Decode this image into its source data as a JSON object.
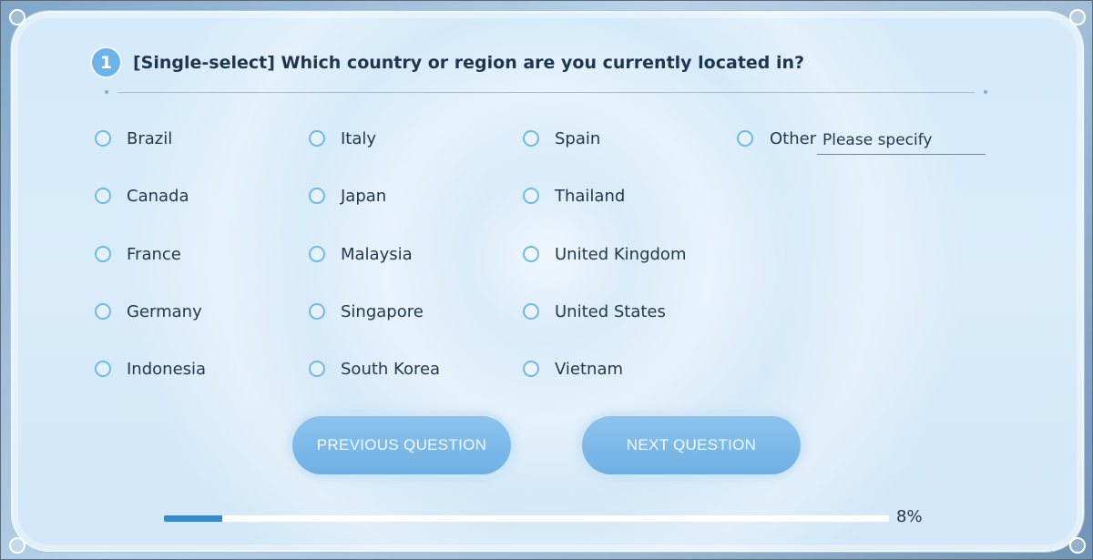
{
  "question": {
    "number": "1",
    "text": "[Single-select] Which country or region are you currently located in?"
  },
  "options": {
    "col1": [
      "Brazil",
      "Canada",
      "France",
      "Germany",
      "Indonesia"
    ],
    "col2": [
      "Italy",
      "Japan",
      "Malaysia",
      "Singapore",
      "South Korea"
    ],
    "col3": [
      "Spain",
      "Thailand",
      "United Kingdom",
      "United States",
      "Vietnam"
    ],
    "other_label": "Other",
    "other_placeholder": "Please specify"
  },
  "buttons": {
    "previous": "PREVIOUS QUESTION",
    "next": "NEXT QUESTION"
  },
  "progress": {
    "value": 0.08,
    "label": "8%"
  },
  "colors": {
    "accent": "#6bb4ea",
    "progress_fill": "#3a87c9"
  }
}
